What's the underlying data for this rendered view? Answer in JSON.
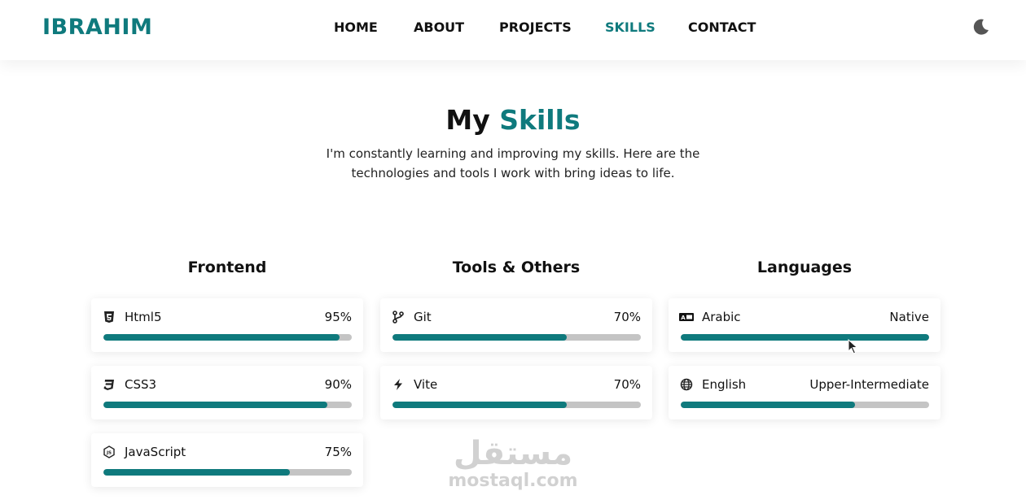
{
  "nav": {
    "brand": "IBRAHIM",
    "links": [
      {
        "label": "HOME",
        "active": false
      },
      {
        "label": "ABOUT",
        "active": false
      },
      {
        "label": "PROJECTS",
        "active": false
      },
      {
        "label": "SKILLS",
        "active": true
      },
      {
        "label": "CONTACT",
        "active": false
      }
    ],
    "theme_icon": "moon-icon"
  },
  "hero": {
    "title_prefix": "My",
    "title_accent": "Skills",
    "description": "I'm constantly learning and improving my skills. Here are the technologies and tools I work with bring ideas to life."
  },
  "columns": [
    {
      "title": "Frontend",
      "skills": [
        {
          "name": "Html5",
          "level": "95%",
          "progress": 0.95,
          "icon": "html5-icon"
        },
        {
          "name": "CSS3",
          "level": "90%",
          "progress": 0.9,
          "icon": "css3-icon"
        },
        {
          "name": "JavaScript",
          "level": "75%",
          "progress": 0.75,
          "icon": "javascript-icon"
        }
      ]
    },
    {
      "title": "Tools & Others",
      "skills": [
        {
          "name": "Git",
          "level": "70%",
          "progress": 0.7,
          "icon": "git-branch-icon"
        },
        {
          "name": "Vite",
          "level": "70%",
          "progress": 0.7,
          "icon": "lightning-icon"
        }
      ]
    },
    {
      "title": "Languages",
      "skills": [
        {
          "name": "Arabic",
          "level": "Native",
          "progress": 1.0,
          "icon": "language-icon"
        },
        {
          "name": "English",
          "level": "Upper-Intermediate",
          "progress": 0.7,
          "icon": "globe-icon"
        }
      ]
    }
  ],
  "watermark": {
    "arabic": "مستقل",
    "latin": "mostaql.com"
  },
  "colors": {
    "accent": "#0f7a7d",
    "track": "#c4c4c4",
    "text": "#111111"
  }
}
